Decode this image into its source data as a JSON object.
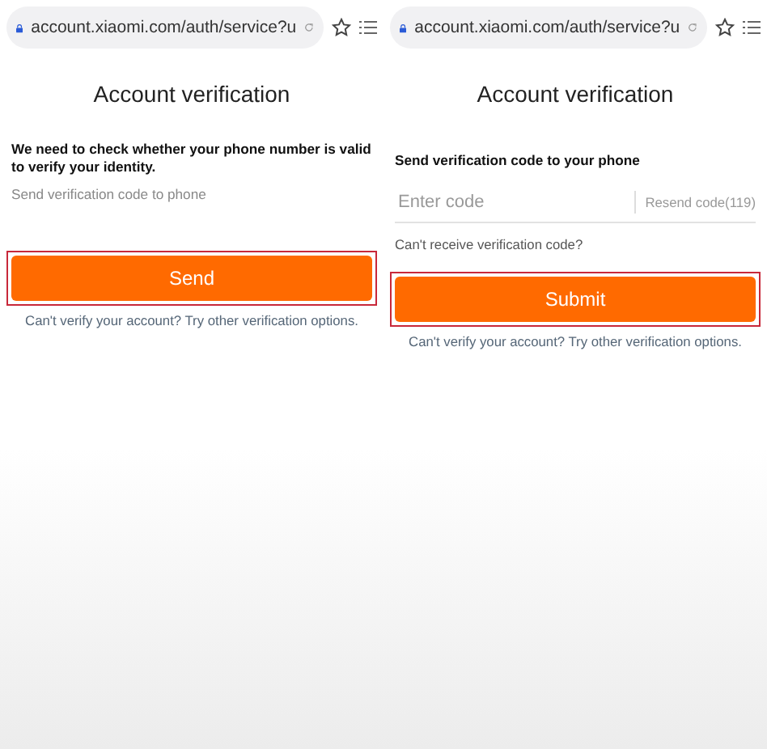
{
  "panels": [
    {
      "kind": "send",
      "url": "account.xiaomi.com/auth/service?u",
      "title": "Account verification",
      "heading": "We need to check whether your phone number is valid to verify your identity.",
      "note": "Send verification code to phone",
      "button": {
        "label": "Send",
        "highlighted": true
      },
      "footer_link": "Can't verify your account? Try other verification options."
    },
    {
      "kind": "code",
      "url": "account.xiaomi.com/auth/service?u",
      "title": "Account verification",
      "heading": "Send verification code to your phone",
      "code_field": {
        "placeholder": "Enter code",
        "resend": "Resend code(119)"
      },
      "help_link": "Can't receive verification code?",
      "button": {
        "label": "Submit",
        "highlighted": true
      },
      "footer_link": "Can't verify your account? Try other verification options."
    }
  ]
}
